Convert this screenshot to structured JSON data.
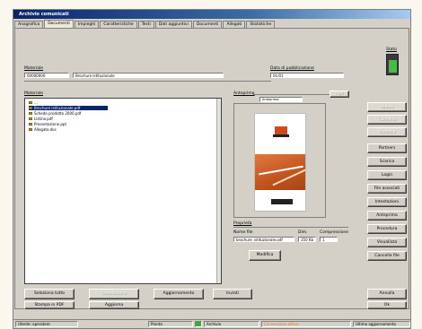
{
  "window": {
    "title": "Archivio comunicati"
  },
  "tabs": [
    {
      "label": "Anagrafica"
    },
    {
      "label": "Documenti"
    },
    {
      "label": "Impieghi"
    },
    {
      "label": "Caratteristiche"
    },
    {
      "label": "Testi"
    },
    {
      "label": "Dati aggiuntivi"
    },
    {
      "label": "Documenti"
    },
    {
      "label": "Allegati"
    },
    {
      "label": "Statistiche"
    }
  ],
  "fields": {
    "document_label": "Materiale",
    "document_code": "00000000",
    "document_name": "Brochure Istituzionale",
    "date_label": "Data di pubblicazione",
    "date_value": "01/01",
    "gauge_label": "Stato",
    "gauge_level": 0.72
  },
  "tree": {
    "label": "Materiale",
    "root": "...",
    "items": [
      {
        "label": "Brochure istituzionale.pdf",
        "selected": true
      },
      {
        "label": "Scheda prodotto 2000.pdf",
        "selected": false
      },
      {
        "label": "Listino.pdf",
        "selected": false
      },
      {
        "label": "Presentazione.ppt",
        "selected": false
      },
      {
        "label": "Allegato.doc",
        "selected": false
      }
    ]
  },
  "preview": {
    "label": "Anteprima",
    "header_tab": "Anteprima",
    "side_button": "Apri"
  },
  "properties": {
    "label": "Proprietà",
    "col1_label": "Nome file",
    "col1_value": "brochure_istituzionale.pdf",
    "col2_label": "Dim.",
    "col2_value": "350 Kb",
    "col3_label": "Compressione",
    "col3_value": "1",
    "modify_button": "Modifica"
  },
  "side_buttons": [
    {
      "label": "Nuovo",
      "disabled": true
    },
    {
      "label": "Cancella",
      "disabled": true
    },
    {
      "label": "Modifica",
      "disabled": true
    },
    {
      "label": "Partners",
      "disabled": false
    },
    {
      "label": "Scarica",
      "disabled": false
    },
    {
      "label": "Login",
      "disabled": false
    },
    {
      "label": "File associati",
      "disabled": false
    },
    {
      "label": "Intestazioni",
      "disabled": false
    },
    {
      "label": "Anteprima",
      "disabled": false
    },
    {
      "label": "Procedura",
      "disabled": false
    },
    {
      "label": "Visualizza",
      "disabled": false
    },
    {
      "label": "Cancella file",
      "disabled": false
    }
  ],
  "bottom_buttons": {
    "row1": [
      {
        "label": "Seleziona tutto",
        "disabled": false
      },
      {
        "label": "Deseleziona",
        "disabled": true
      },
      {
        "label": "Aggiornamento",
        "disabled": false
      },
      {
        "label": "Inviati",
        "disabled": false
      }
    ],
    "row2": [
      {
        "label": "Stampa in PDF",
        "disabled": false
      },
      {
        "label": "Aggiorna",
        "disabled": false
      }
    ],
    "annulla": "Annulla",
    "ok": "Ok"
  },
  "statusbar": {
    "cell1": "Utente: operatore",
    "cell2": "Pronto",
    "cell3": "Archivio",
    "cell4": "Connessione attiva",
    "cell5": "Ultimo aggiornamento",
    "accent_color": "#e08020"
  }
}
